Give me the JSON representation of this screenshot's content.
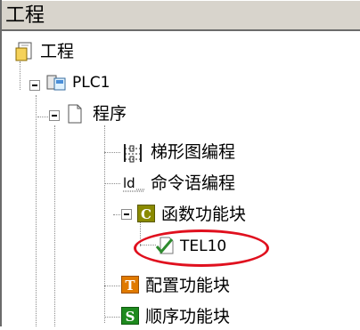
{
  "panel": {
    "title": "工程"
  },
  "tree": {
    "root": {
      "label": "工程"
    },
    "plc": {
      "label": "PLC1"
    },
    "program": {
      "label": "程序"
    },
    "items": {
      "ladder": {
        "label": "梯形图编程"
      },
      "instruction": {
        "label": "命令语编程"
      },
      "function_block": {
        "label": "函数功能块",
        "icon_letter": "C"
      },
      "tel10": {
        "label": "TEL10"
      },
      "config_block": {
        "label": "配置功能块",
        "icon_letter": "T"
      },
      "sequence_block": {
        "label": "顺序功能块",
        "icon_letter": "S"
      }
    }
  },
  "colors": {
    "highlight": "#e0101e",
    "c_icon": "#8a8a00",
    "t_icon": "#e07a00",
    "s_icon": "#1e8a1e"
  }
}
